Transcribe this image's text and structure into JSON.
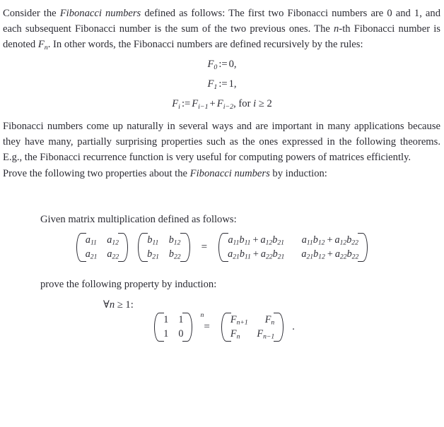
{
  "document": {
    "intro": {
      "before_italic": "Consider the ",
      "italic_term": "Fibonacci numbers",
      "after_italic": " defined as follows: The first two Fibonacci numbers are 0 and 1, and each subsequent Fibonacci number is the sum of the two previous ones. The ",
      "n_var": "n",
      "after_n": "-th Fibonacci number is denoted ",
      "F_symbol": "F",
      "F_sub": "n",
      "tail": ". In other words, the Fibonacci numbers are defined recursively by the rules:"
    },
    "definitions": [
      {
        "lhs": "F",
        "lhs_sub": "0",
        "assign": ":=",
        "rhs": "0",
        "punct": ","
      },
      {
        "lhs": "F",
        "lhs_sub": "1",
        "assign": ":=",
        "rhs": "1",
        "punct": ","
      },
      {
        "lhs": "F",
        "lhs_sub": "i",
        "assign": ":=",
        "term1": "F",
        "term1_sub": "i−1",
        "plus": "+",
        "term2": "F",
        "term2_sub": "i−2",
        "punct": ",",
        "condition_text": "for ",
        "condition_var": "i",
        "condition_rel": " ≥ 2"
      }
    ],
    "discussion": "Fibonacci numbers come up naturally in several ways and are important in many applications because they have many, partially surprising properties such as the ones expressed in the following theorems. E.g., the Fibonacci recurrence function is very useful for computing powers of matrices efficiently.",
    "prove_line": {
      "before_italic": "Prove the following two properties about the ",
      "italic_term": "Fibonacci numbers",
      "after_italic": " by induction:"
    },
    "given_line": "Given matrix multiplication defined as follows:",
    "matrix_mult": {
      "A": {
        "rows": [
          [
            "a",
            "a"
          ],
          [
            "a",
            "a"
          ]
        ],
        "subs": [
          [
            "11",
            "12"
          ],
          [
            "21",
            "22"
          ]
        ]
      },
      "B": {
        "rows": [
          [
            "b",
            "b"
          ],
          [
            "b",
            "b"
          ]
        ],
        "subs": [
          [
            "11",
            "12"
          ],
          [
            "21",
            "22"
          ]
        ]
      },
      "equals": "=",
      "product": {
        "r1c1": {
          "t1": "a",
          "s1": "11",
          "t2": "b",
          "s2": "11",
          "plus": "+",
          "t3": "a",
          "s3": "12",
          "t4": "b",
          "s4": "21"
        },
        "r1c2": {
          "t1": "a",
          "s1": "11",
          "t2": "b",
          "s2": "12",
          "plus": "+",
          "t3": "a",
          "s3": "12",
          "t4": "b",
          "s4": "22"
        },
        "r2c1": {
          "t1": "a",
          "s1": "21",
          "t2": "b",
          "s2": "11",
          "plus": "+",
          "t3": "a",
          "s3": "22",
          "t4": "b",
          "s4": "21"
        },
        "r2c2": {
          "t1": "a",
          "s1": "21",
          "t2": "b",
          "s2": "12",
          "plus": "+",
          "t3": "a",
          "s3": "22",
          "t4": "b",
          "s4": "22"
        }
      }
    },
    "prove_property_line": "prove the following property by induction:",
    "quantifier": {
      "symbol": "∀",
      "var": "n",
      "relation": " ≥ 1:"
    },
    "power_identity": {
      "base": {
        "r1": [
          "1",
          "1"
        ],
        "r2": [
          "1",
          "0"
        ]
      },
      "exponent": "n",
      "equals": "=",
      "result": {
        "r1c1_sym": "F",
        "r1c1_sub": "n+1",
        "r1c2_sym": "F",
        "r1c2_sub": "n",
        "r2c1_sym": "F",
        "r2c1_sub": "n",
        "r2c2_sym": "F",
        "r2c2_sub": "n−1"
      },
      "trailing_punct": "."
    }
  }
}
